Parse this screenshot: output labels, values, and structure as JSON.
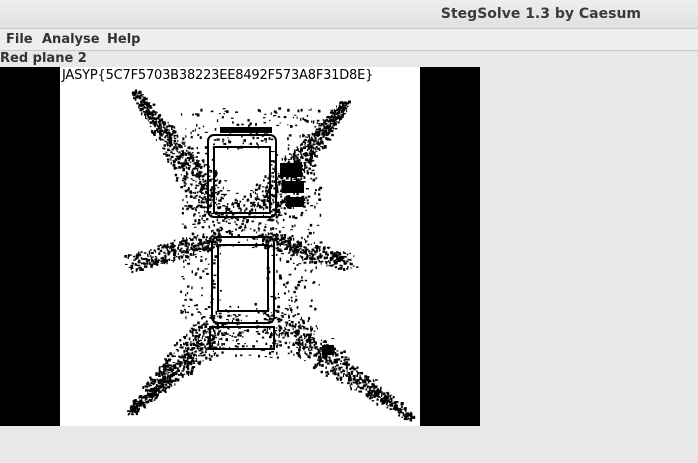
{
  "window": {
    "title": "StegSolve 1.3 by Caesum"
  },
  "menu": {
    "items": [
      {
        "label": "File"
      },
      {
        "label": "Analyse"
      },
      {
        "label": "Help"
      }
    ]
  },
  "viewer": {
    "plane_label": "Red plane 2",
    "hidden_text": "JASYP{5C7F5703B38223EE8492F573A8F31D8E}"
  }
}
